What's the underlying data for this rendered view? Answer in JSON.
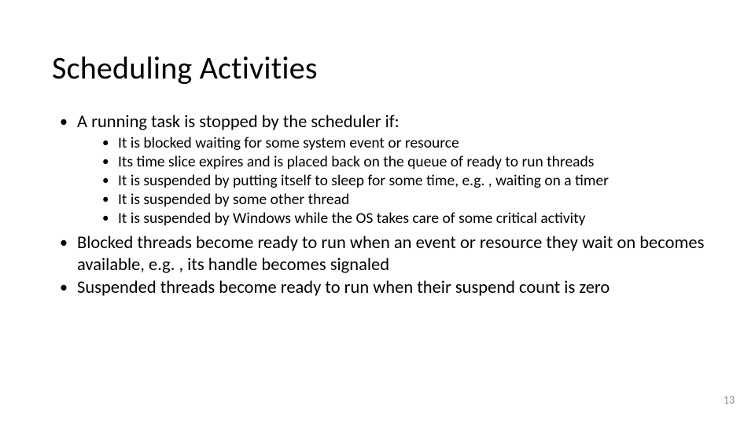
{
  "title": "Scheduling Activities",
  "bullets": {
    "b1": "A running task is stopped by the scheduler if:",
    "sub": {
      "s1": "It is blocked waiting for some system event or resource",
      "s2": "Its time slice expires and is placed back on the queue of ready to run threads",
      "s3": "It is suspended by putting itself to sleep for some time, e.g. , waiting on a timer",
      "s4": "It is suspended by some other thread",
      "s5": "It is suspended by Windows while the OS takes care of some critical activity"
    },
    "b2": "Blocked threads become ready to run when an event or resource they wait on becomes available, e.g. , its handle becomes signaled",
    "b3": "Suspended threads become ready to run when their suspend count is zero"
  },
  "page_number": "13"
}
